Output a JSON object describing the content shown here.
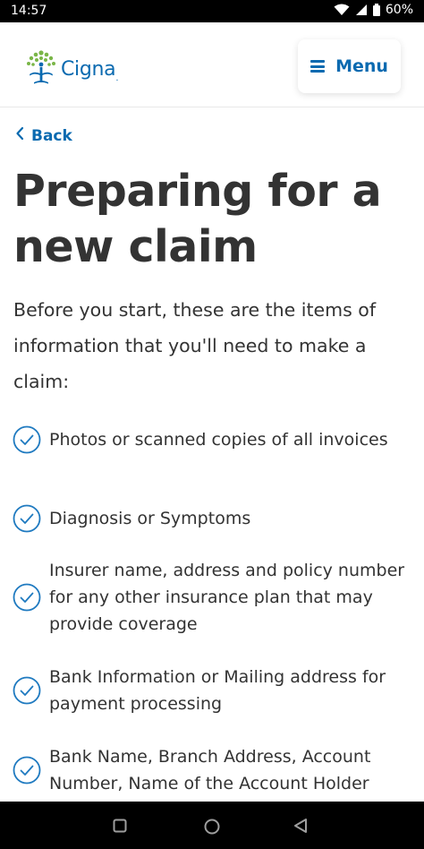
{
  "status_bar": {
    "time": "14:57",
    "battery": "60%",
    "icons": [
      "wifi-icon",
      "signal-icon",
      "battery-icon"
    ]
  },
  "header": {
    "logo_text": "Cigna",
    "logo_suffix": ".",
    "menu_label": "Menu"
  },
  "back_label": "Back",
  "page_title": "Preparing for a new claim",
  "intro": "Before you start, these are the items of information that you'll need to make a claim:",
  "checklist": [
    {
      "text": "Photos or scanned copies of all invoices"
    },
    {
      "text": "Diagnosis or Symptoms"
    },
    {
      "text": "Insurer name, address and policy number for any other insurance plan that may provide coverage"
    },
    {
      "text": "Bank Information or Mailing address for payment processing"
    },
    {
      "text": "Bank Name, Branch Address, Account Number, Name of the Account Holder"
    }
  ],
  "nav_bar": {
    "buttons": [
      "recents-button",
      "home-button",
      "back-button"
    ]
  },
  "colors": {
    "brand_blue": "#0a6ab0",
    "logo_green": "#7ab648",
    "text": "#333333",
    "check_stroke": "#1f7ac0"
  }
}
